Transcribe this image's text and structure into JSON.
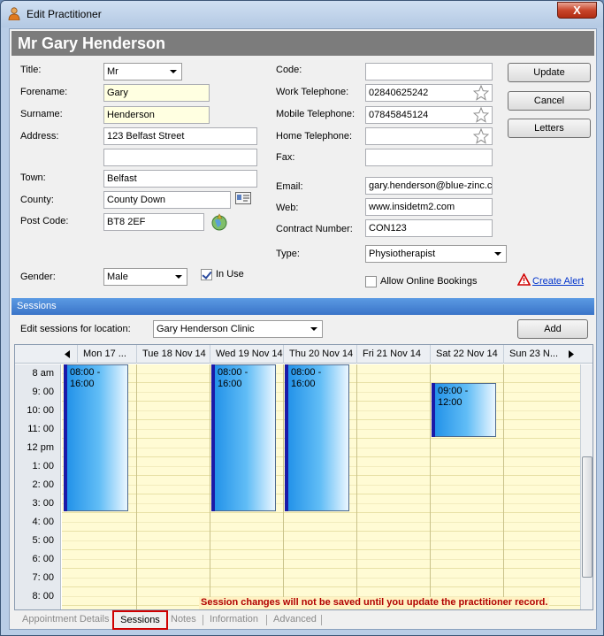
{
  "window": {
    "title": "Edit Practitioner",
    "close_glyph": "X"
  },
  "header": {
    "name": "Mr Gary Henderson"
  },
  "form": {
    "title_label": "Title:",
    "title_value": "Mr",
    "forename_label": "Forename:",
    "forename_value": "Gary",
    "surname_label": "Surname:",
    "surname_value": "Henderson",
    "address_label": "Address:",
    "address1_value": "123 Belfast Street",
    "address2_value": "",
    "town_label": "Town:",
    "town_value": "Belfast",
    "county_label": "County:",
    "county_value": "County Down",
    "postcode_label": "Post Code:",
    "postcode_value": "BT8 2EF",
    "gender_label": "Gender:",
    "gender_value": "Male",
    "inuse_label": "In Use",
    "inuse_checked": true,
    "code_label": "Code:",
    "code_value": "",
    "work_tel_label": "Work Telephone:",
    "work_tel_value": "02840625242",
    "mobile_tel_label": "Mobile Telephone:",
    "mobile_tel_value": "07845845124",
    "home_tel_label": "Home Telephone:",
    "home_tel_value": "",
    "fax_label": "Fax:",
    "fax_value": "",
    "email_label": "Email:",
    "email_value": "gary.henderson@blue-zinc.c",
    "web_label": "Web:",
    "web_value": "www.insidetm2.com",
    "contract_label": "Contract Number:",
    "contract_value": "CON123",
    "type_label": "Type:",
    "type_value": "Physiotherapist",
    "online_label": "Allow Online Bookings",
    "online_checked": false,
    "alert_link": "Create Alert"
  },
  "buttons": {
    "update": "Update",
    "cancel": "Cancel",
    "letters": "Letters",
    "add": "Add"
  },
  "sessions": {
    "section_title": "Sessions",
    "location_label": "Edit sessions for location:",
    "location_value": "Gary Henderson Clinic",
    "days": [
      "Mon 17 ...",
      "Tue 18 Nov 14",
      "Wed 19 Nov 14",
      "Thu 20 Nov 14",
      "Fri 21 Nov 14",
      "Sat 22 Nov 14",
      "Sun 23 N..."
    ],
    "times": [
      "8  am",
      "9: 00",
      "10: 00",
      "11: 00",
      "12  pm",
      "1: 00",
      "2: 00",
      "3: 00",
      "4: 00",
      "5: 00",
      "6: 00",
      "7: 00",
      "8: 00"
    ],
    "appointments": [
      {
        "day": 0,
        "start": "08:00 -",
        "end": "16:00"
      },
      {
        "day": 2,
        "start": "08:00 -",
        "end": "16:00"
      },
      {
        "day": 3,
        "start": "08:00 -",
        "end": "16:00"
      },
      {
        "day": 5,
        "start": "09:00 -",
        "end": "12:00"
      }
    ],
    "warning": "Session changes will not be saved until you update the practitioner record."
  },
  "tabs": [
    "Appointment Details",
    "Sessions",
    "Notes",
    "Information",
    "Advanced"
  ],
  "active_tab": "Sessions",
  "colors": {
    "header": "#7c7c7c",
    "section_bar": "#3a74c8",
    "calendar_bg": "#fffbd4",
    "warning": "#b10000",
    "link": "#0033cc",
    "highlight": "#d00000"
  }
}
